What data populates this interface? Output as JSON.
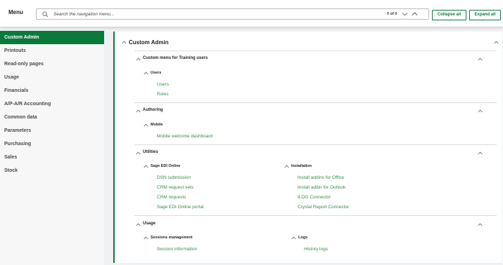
{
  "topbar": {
    "menu_label": "Menu",
    "search_placeholder": "Search the navigation menu...",
    "search_count": "0 of 0",
    "collapse_label": "Collapse all",
    "expand_label": "Expand all"
  },
  "sidebar": {
    "items": [
      {
        "label": "Custom Admin",
        "active": true
      },
      {
        "label": "Printouts"
      },
      {
        "label": "Read-only pages"
      },
      {
        "label": "Usage"
      },
      {
        "label": "Financials"
      },
      {
        "label": "A/P-A/R Accounting"
      },
      {
        "label": "Common data"
      },
      {
        "label": "Parameters"
      },
      {
        "label": "Purchasing"
      },
      {
        "label": "Sales"
      },
      {
        "label": "Stock"
      }
    ]
  },
  "main": {
    "title": "Custom Admin",
    "sections": [
      {
        "title": "Custom menu for Training users",
        "groups": [
          {
            "title": "Users",
            "links": [
              "Users",
              "Roles"
            ]
          }
        ]
      },
      {
        "title": "Authoring",
        "groups": [
          {
            "title": "Mobile",
            "links": [
              "Mobile welcome dashboard"
            ]
          }
        ]
      },
      {
        "title": "Utilities",
        "groups": [
          {
            "title": "Sage EDI Online",
            "links": [
              "DSN submission",
              "CRM request sets",
              "CRM requests",
              "Sage EDI Online portal"
            ]
          },
          {
            "title": "Installation",
            "links": [
              "Install addins for Office",
              "Install addin for Outlook",
              "ILOG Connector",
              "Crystal Report Connector"
            ]
          }
        ]
      },
      {
        "title": "Usage",
        "groups": [
          {
            "title": "Sessions management",
            "links": [
              "Session information"
            ]
          },
          {
            "title": "Logs",
            "links": [
              "History logs"
            ]
          }
        ]
      }
    ]
  },
  "colors": {
    "accent": "#0a7a3c",
    "link": "#3b8c4a",
    "background": "#eef0f1"
  },
  "icons": [
    "search-icon",
    "chevron-up-icon",
    "chevron-down-icon"
  ]
}
